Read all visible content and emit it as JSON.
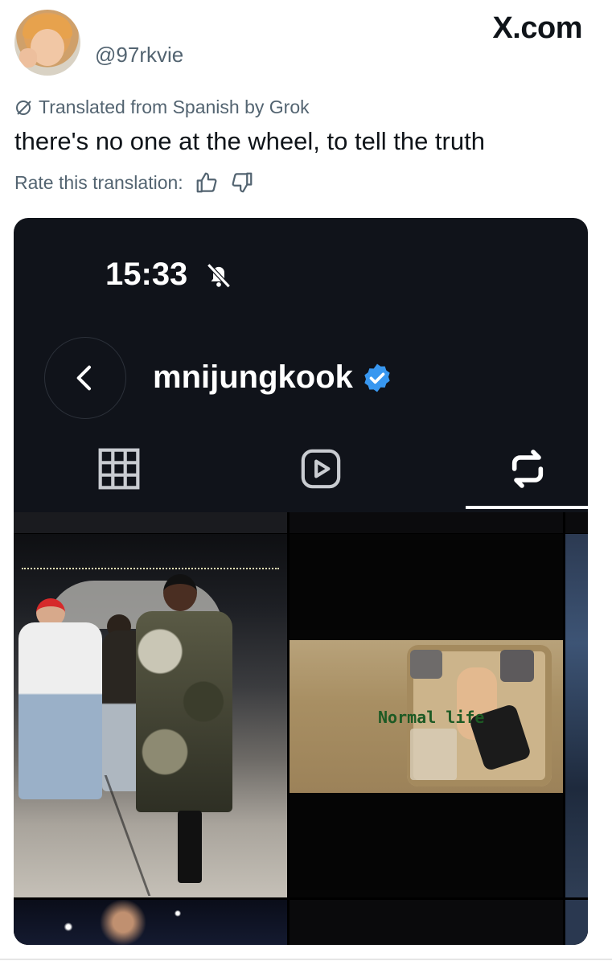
{
  "tweet": {
    "handle": "@97rkvie",
    "site_logo": "X.com",
    "translation_note": "Translated from Spanish by Grok",
    "text": "there's no one at the wheel, to tell the truth",
    "rate_label": "Rate this translation:"
  },
  "screenshot": {
    "time": "15:33",
    "bell_icon": "bell-muted-icon",
    "profile_name": "mnijungkook",
    "verified_color": "#3897f0",
    "tabs": [
      {
        "name": "grid",
        "icon": "grid-icon",
        "active": false
      },
      {
        "name": "reels",
        "icon": "reels-icon",
        "active": false
      },
      {
        "name": "reposts",
        "icon": "repost-icon",
        "active": true
      }
    ],
    "tiles": [
      {
        "label": ""
      },
      {
        "label": "Normal life"
      }
    ]
  },
  "colors": {
    "secondary_text": "#536471",
    "primary_text": "#0f1419",
    "card_bg": "#10131a"
  }
}
